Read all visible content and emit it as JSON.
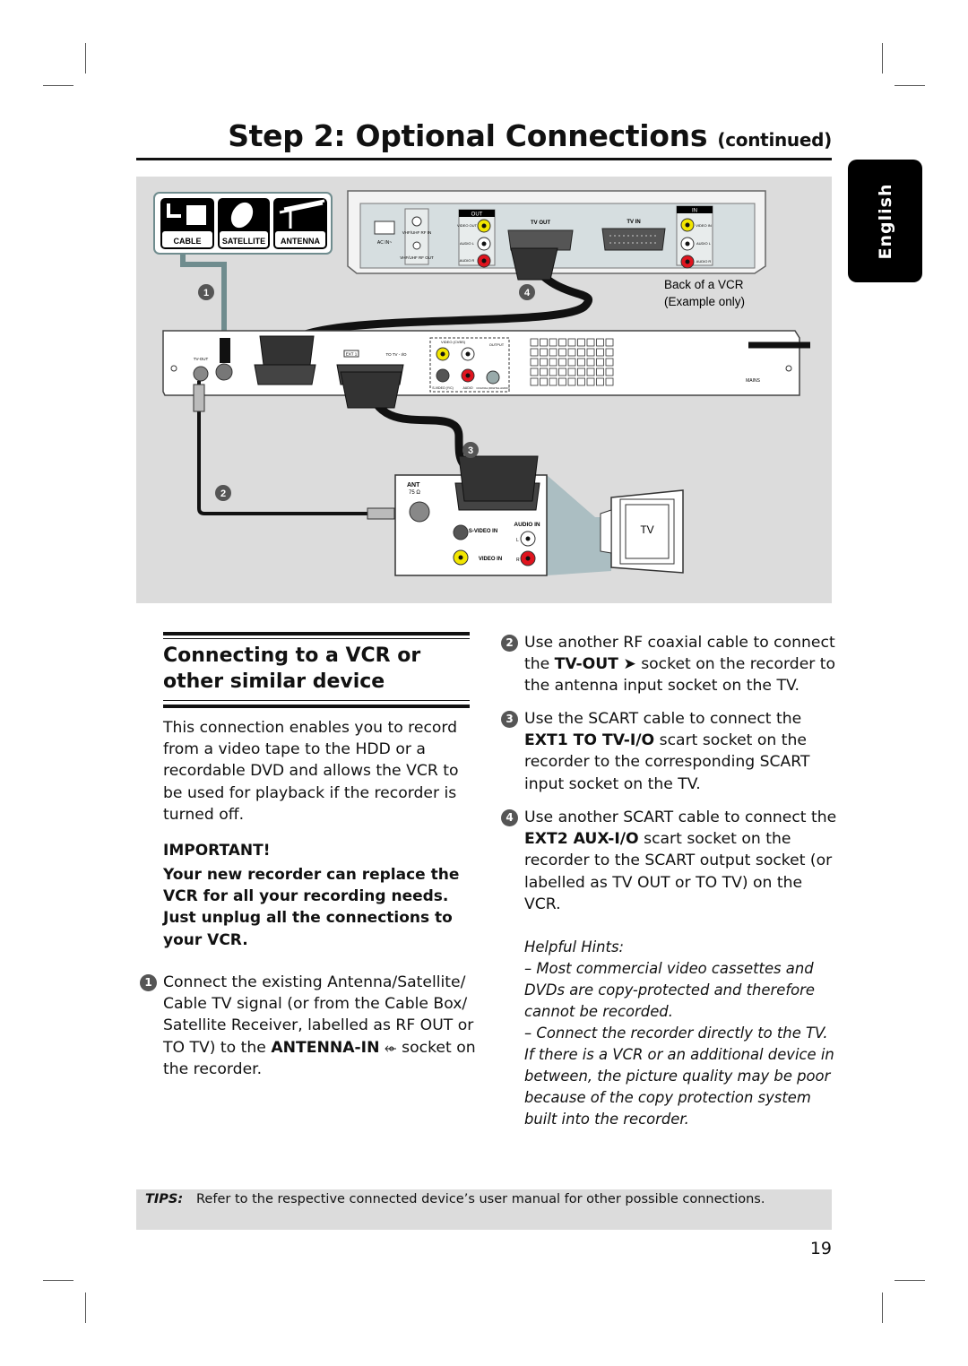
{
  "header": {
    "title": "Step 2: Optional Connections",
    "title_suffix": "(continued)"
  },
  "language_tab": "English",
  "diagram": {
    "source_labels": [
      "CABLE",
      "SATELLITE",
      "ANTENNA"
    ],
    "vcr": {
      "caption_line1": "Back of a VCR",
      "caption_line2": "(Example only)",
      "ac_in": "AC IN~",
      "rf_in": "VHF/UHF RF IN",
      "rf_out": "VHF/UHF RF OUT",
      "out_header": "OUT",
      "in_header": "IN",
      "video_out": "VIDEO OUT",
      "audio_l": "AUDIO L",
      "audio_r": "AUDIO R",
      "tv_out": "TV OUT",
      "tv_in": "TV IN",
      "video_in": "VIDEO IN"
    },
    "recorder": {
      "tv_out": "TV-OUT",
      "ext1": "EXT 1",
      "to_tv_io": "TO TV - I/O",
      "video_cvbs": "VIDEO (CVBS)",
      "output": "OUTPUT",
      "svideo_yc": "S-VIDEO (Y/C)",
      "audio": "AUDIO",
      "coaxial": "COAXIAL (DIGITAL AUDIO)",
      "mains": "MAINS"
    },
    "tv": {
      "ant": "ANT",
      "ant_impedance": "75 Ω",
      "svideo_in": "S-VIDEO IN",
      "audio_in": "AUDIO IN",
      "video_in": "VIDEO IN",
      "l": "L",
      "r": "R",
      "screen_label": "TV"
    },
    "callouts": [
      "1",
      "2",
      "3",
      "4"
    ]
  },
  "section": {
    "heading": "Connecting to a VCR or other similar device",
    "intro": "This connection enables you to record from a video tape to the HDD or a recordable DVD and allows the VCR to be used for playback if the recorder is turned off.",
    "important_label": "IMPORTANT!",
    "important_text": "Your new recorder can replace the VCR for all your recording needs. Just unplug all the connections to your VCR."
  },
  "steps": [
    {
      "num": "1",
      "pre": "Connect the existing Antenna/Satellite/ Cable TV signal (or from the Cable Box/ Satellite Receiver, labelled as RF OUT or TO TV) to the ",
      "bold": "ANTENNA-IN",
      "icon": "antenna-in-icon",
      "post": " socket on the recorder."
    },
    {
      "num": "2",
      "pre": "Use another RF coaxial cable to connect the ",
      "bold": "TV-OUT",
      "icon": "tv-out-icon",
      "post": " socket on the recorder to the antenna input socket on the TV."
    },
    {
      "num": "3",
      "pre": "Use the SCART cable to connect the ",
      "bold": "EXT1 TO TV-I/O",
      "post": " scart socket on the recorder to the corresponding SCART input socket on the TV."
    },
    {
      "num": "4",
      "pre": "Use another SCART cable to connect the ",
      "bold": "EXT2 AUX-I/O",
      "post": " scart socket on the recorder to the SCART output socket (or labelled as TV OUT or TO TV) on the VCR."
    }
  ],
  "hints": {
    "title": "Helpful Hints:",
    "items": [
      "– Most commercial video cassettes and DVDs are copy-protected and therefore cannot be recorded.",
      "– Connect the recorder directly to the TV. If there is a VCR or an additional device in between, the picture quality may be poor because of the copy protection system built into the recorder."
    ]
  },
  "tips": {
    "label": "TIPS:",
    "text": "Refer to the respective connected device’s user manual for other possible connections."
  },
  "page_number": "19",
  "colors": {
    "diagram_bg": "#dcdcdc",
    "cable_teal": "#6f8c8e",
    "jack_yellow": "#f2e600",
    "jack_red": "#e0141e",
    "callout_gray": "#555555"
  }
}
